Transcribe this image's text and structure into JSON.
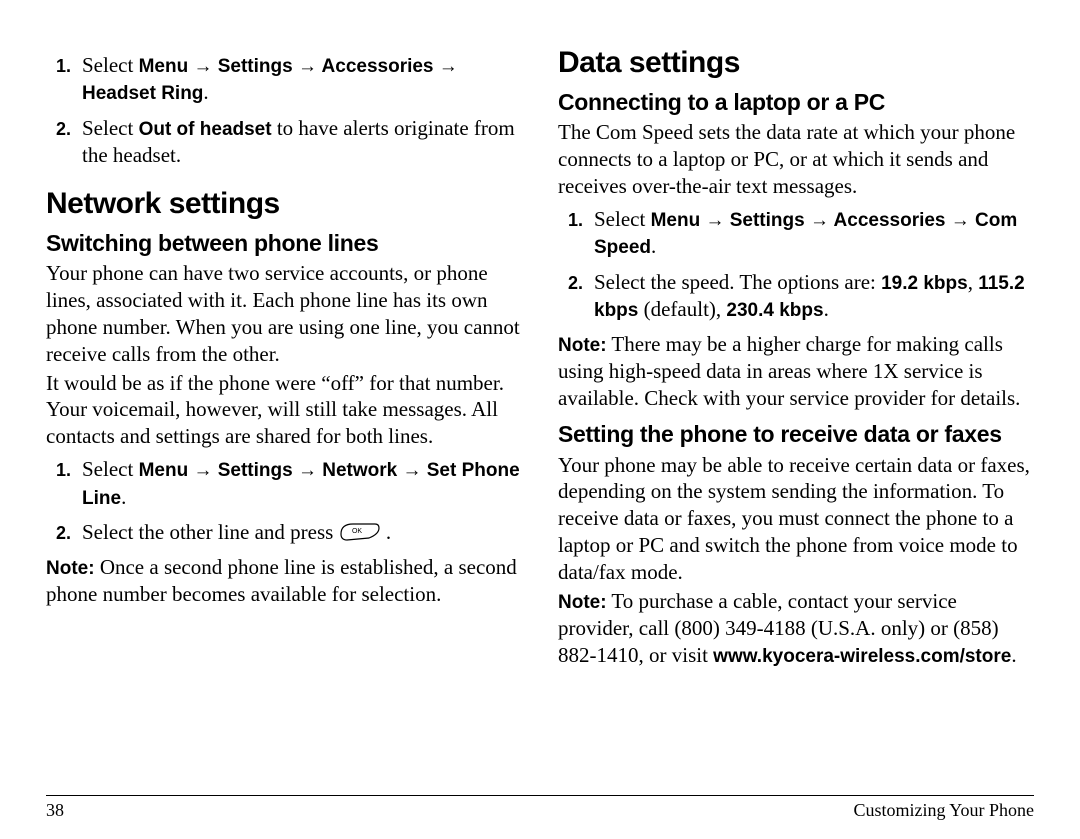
{
  "left": {
    "intro_list": {
      "li1_pre": "Select ",
      "li1_menu": "Menu → Settings → Accessories → Headset Ring",
      "li1_post": ".",
      "li2_pre": "Select ",
      "li2_bold": "Out of headset",
      "li2_post": " to have alerts originate from the headset."
    },
    "h1": "Network settings",
    "h2": "Switching between phone lines",
    "p1": "Your phone can have two service accounts, or phone lines, associated with it. Each phone line has its own phone number. When you are using one line, you cannot receive calls from the other.",
    "p2": "It would be as if the phone were “off” for that number. Your voicemail, however, will still take messages. All contacts and settings are shared for both lines.",
    "steps": {
      "li1_pre": "Select ",
      "li1_menu": "Menu → Settings → Network → Set Phone Line",
      "li1_post": ".",
      "li2_pre": "Select the other line and press ",
      "li2_post": " ."
    },
    "note_label": "Note:",
    "note_body": "  Once a second phone line is established, a second phone number becomes available for selection."
  },
  "right": {
    "h1": "Data settings",
    "h2a": "Connecting to a laptop or a PC",
    "p1": "The Com Speed sets the data rate at which your phone connects to a laptop or PC, or at which it sends and receives over-the-air text messages.",
    "steps": {
      "li1_pre": "Select ",
      "li1_menu": "Menu → Settings → Accessories → Com Speed",
      "li1_post": ".",
      "li2_pre": "Select the speed. The options are: ",
      "li2_opt1": "19.2 kbps",
      "li2_mid1": ", ",
      "li2_opt2": "115.2 kbps",
      "li2_mid2": " (default), ",
      "li2_opt3": "230.4 kbps",
      "li2_post": "."
    },
    "note1_label": "Note:",
    "note1_body": "  There may be a higher charge for making calls using high-speed data in areas where 1X service is available. Check with your service provider for details.",
    "h2b": "Setting the phone to receive data or faxes",
    "p2": "Your phone may be able to receive certain data or faxes, depending on the system sending the information. To receive data or faxes, you must connect the phone to a laptop or PC and switch the phone from voice mode to data/fax mode.",
    "note2_label": "Note:",
    "note2_body_a": "  To purchase a cable, contact your service provider, call (800) 349-4188 (U.S.A. only) or (858) 882-1410, or visit ",
    "note2_url": "www.kyocera-wireless.com/store",
    "note2_body_b": "."
  },
  "footer": {
    "page_num": "38",
    "chapter": "Customizing Your Phone"
  }
}
